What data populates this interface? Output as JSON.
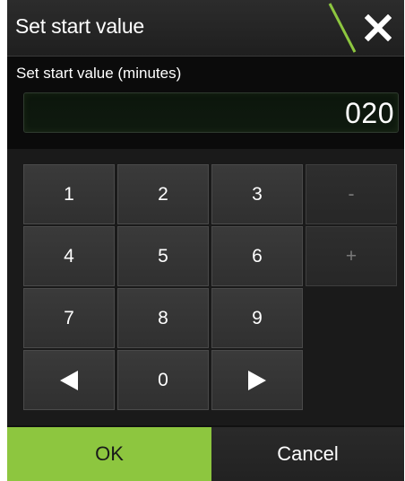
{
  "dialog": {
    "title": "Set start value",
    "close_icon": "close-icon",
    "accent_color": "#8dc63f"
  },
  "field": {
    "label": "Set start value (minutes)",
    "value": "020"
  },
  "keypad": {
    "keys": [
      "1",
      "2",
      "3",
      "-",
      "4",
      "5",
      "6",
      "+",
      "7",
      "8",
      "9",
      "0"
    ],
    "left_arrow_icon": "arrow-left-icon",
    "right_arrow_icon": "arrow-right-icon"
  },
  "buttons": {
    "ok": "OK",
    "cancel": "Cancel"
  }
}
